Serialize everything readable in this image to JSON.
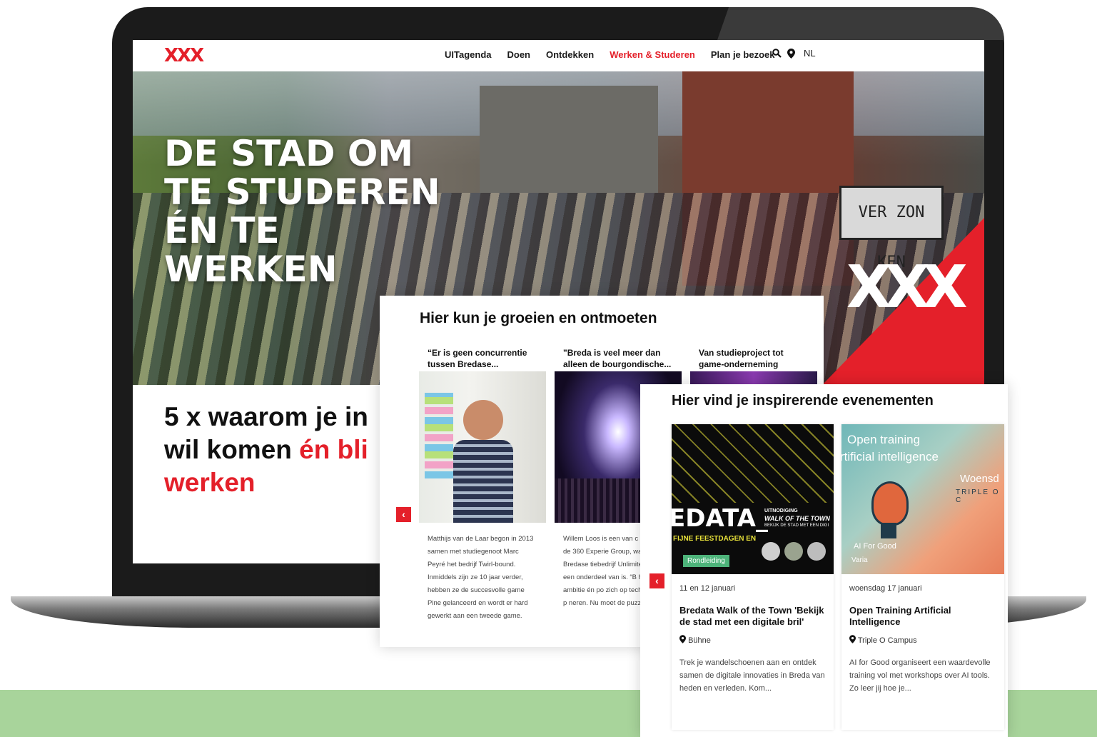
{
  "nav": {
    "logo": "XXX",
    "items": [
      "UITagenda",
      "Doen",
      "Ontdekken",
      "Werken & Studeren",
      "Plan je bezoek"
    ],
    "active": "Werken & Studeren",
    "lang": "NL"
  },
  "hero": {
    "title": "DE STAD OM TE STUDEREN ÉN TE WERKEN",
    "banner_text": "VER ZON KEN"
  },
  "subtitle": {
    "line1": "5 x waarom je in",
    "line2_black": "wil komen ",
    "line2_red": "én bli",
    "line3_red": "werken"
  },
  "panel1": {
    "heading": "Hier kun je groeien en ontmoeten",
    "cards": [
      {
        "title": "“Er is geen concurrentie tussen Bredase...",
        "body": "Matthijs van de Laar begon in 2013 samen met studiegenoot Marc Peyré het bedrijf Twirl-bound. Inmiddels zijn ze 10 jaar verder, hebben ze de succesvolle game Pine gelanceerd en wordt er hard gewerkt aan een tweede game."
      },
      {
        "title": "\"Breda is veel meer dan alleen de bourgondische...",
        "body": "Willem Loos is een van c ders van de 360 Experie Group, waar het Bredase tiebedrijf Unlimited Proc een onderdeel van is. “B heeft veel ambitie én po zich op tech-gebied te p neren. Nu moet de puzz worden.”"
      },
      {
        "title": "Van studieproject tot game-onderneming",
        "body": ""
      }
    ]
  },
  "panel2": {
    "heading": "Hier vind je inspirerende evenementen",
    "events": [
      {
        "image_text_main": "EDATA_",
        "image_text_sub": "FIJNE FEESTDAGEN EN",
        "image_text_sub2": "UITNODIGING",
        "image_text_sub3": "WALK OF THE TOWN",
        "image_text_sub4": "BEKIJK DE STAD MET EEN DIGI",
        "tag": "Rondleiding",
        "date": "11 en 12 januari",
        "title": "Bredata Walk of the Town 'Bekijk de stad met een digitale bril'",
        "location": "Bühne",
        "description": "Trek je wandelschoenen aan en ontdek samen de digitale innovaties in Breda van heden en verleden. Kom..."
      },
      {
        "image_text_main": "Open training",
        "image_text_sub": "rtificial intelligence",
        "image_text_sub2": "Woensd",
        "image_text_sub3": "TRIPLE O C",
        "image_text_sub4": "AI For Good",
        "tag": "Varia",
        "date": "woensdag 17 januari",
        "title": "Open Training Artificial Intelligence",
        "location": "Triple O Campus",
        "description": "AI for Good organiseert een waardevolle training vol met workshops over AI tools. Zo leer jij hoe je..."
      }
    ]
  },
  "colors": {
    "brand_red": "#e4202a",
    "floor_green": "#a8d49b",
    "tag_green": "#4db37a"
  }
}
